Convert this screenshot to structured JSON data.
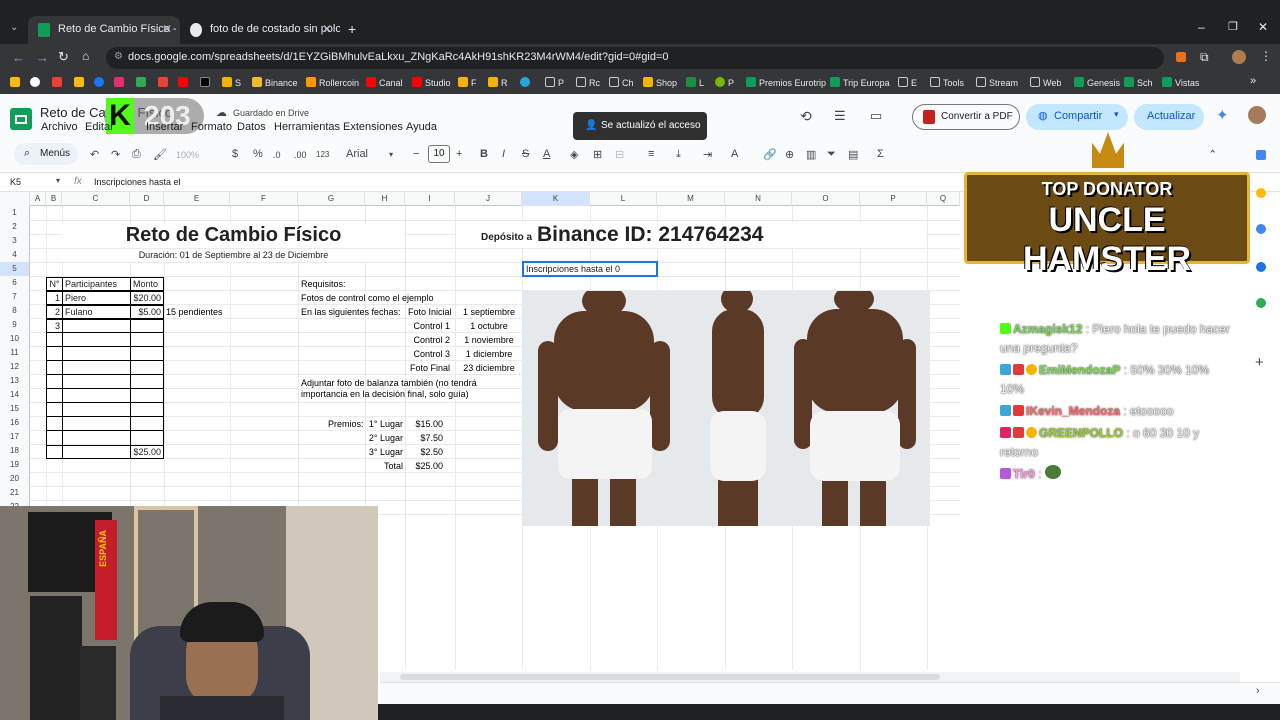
{
  "browser": {
    "tabs": [
      {
        "title": "Reto de Cambio Físico - Hojas d",
        "active": true
      },
      {
        "title": "foto de de costado sin polo - B",
        "active": false
      }
    ],
    "url": "docs.google.com/spreadsheets/d/1EYZGiBMhulvEaLkxu_ZNgKaRc4AkH91shKR23M4rWM4/edit?gid=0#gid=0",
    "bookmarks": [
      "S",
      "Binance",
      "Rollercoin",
      "Canal",
      "Studio",
      "F",
      "R",
      "P",
      "Rc",
      "Ch",
      "Shop",
      "L",
      "P",
      "Premios Eurotrip",
      "Trip Europa",
      "E",
      "Tools",
      "Stream",
      "Web",
      "Genesis",
      "Sch",
      "Vistas"
    ]
  },
  "app": {
    "doc_title": "Reto de Cambio Físico",
    "saved_status": "Guardado en Drive",
    "menus": [
      "Archivo",
      "Editar",
      "Ver",
      "Insertar",
      "Formato",
      "Datos",
      "Herramientas",
      "Extensiones",
      "Ayuda"
    ],
    "toast": "Se actualizó el acceso",
    "convert_pdf": "Convertir a PDF",
    "share": "Compartir",
    "update": "Actualizar",
    "overlay_number": "203"
  },
  "toolbar": {
    "menus_label": "Menús",
    "zoom": "100%",
    "currency": "$",
    "percent": "%",
    "dec_less": ".0",
    "dec_more": ".00",
    "number_fmt": "123",
    "font": "Arial",
    "font_size": "10"
  },
  "formula_bar": {
    "cell_ref": "K5",
    "content": "Inscripciones hasta el"
  },
  "columns": [
    "A",
    "B",
    "C",
    "D",
    "E",
    "F",
    "G",
    "H",
    "I",
    "J",
    "K",
    "L",
    "M",
    "N",
    "O",
    "P",
    "Q"
  ],
  "rows": [
    "1",
    "2",
    "3",
    "4",
    "5",
    "6",
    "7",
    "8",
    "9",
    "10",
    "11",
    "12",
    "13",
    "14",
    "15",
    "16",
    "17",
    "18",
    "19",
    "20",
    "21",
    "22"
  ],
  "sheet": {
    "title": "Reto de Cambio Físico",
    "duration": "Duración: 01 de Septiembre al 23 de Diciembre",
    "deposit_label": "Depósito a",
    "binance": "Binance ID: 214764234",
    "active_cell_text": "Inscripciones hasta el 0",
    "table_headers": [
      "N°",
      "Participantes",
      "Monto"
    ],
    "table_rows": [
      {
        "n": "1",
        "name": "Piero",
        "amount": "$20.00"
      },
      {
        "n": "2",
        "name": "Fulano",
        "amount": "$5.00"
      },
      {
        "n": "3",
        "name": "",
        "amount": ""
      }
    ],
    "pending": "15 pendientes",
    "table_total": "$25.00",
    "requirements": "Requisitos:",
    "control_photos": "Fotos de control como el ejemplo",
    "dates_label": "En las siguientes fechas:",
    "schedule": [
      {
        "label": "Foto Inicial",
        "date": "1 septiembre"
      },
      {
        "label": "Control 1",
        "date": "1 octubre"
      },
      {
        "label": "Control 2",
        "date": "1 noviembre"
      },
      {
        "label": "Control 3",
        "date": "1 diciembre"
      },
      {
        "label": "Foto Final",
        "date": "23 diciembre"
      }
    ],
    "scale_note_1": "Adjuntar foto de balanza también (no tendrá",
    "scale_note_2": "importancia en la decisión final, solo guía)",
    "prizes_label": "Premios:",
    "prizes": [
      {
        "place": "1° Lugar",
        "amount": "$15.00"
      },
      {
        "place": "2° Lugar",
        "amount": "$7.50"
      },
      {
        "place": "3° Lugar",
        "amount": "$2.50"
      },
      {
        "place": "Total",
        "amount": "$25.00"
      }
    ]
  },
  "overlay": {
    "donor_top": "TOP DONATOR",
    "donor_name": "UNCLE HAMSTER",
    "camera_flag": "ESPAÑA",
    "chat": [
      {
        "user": "Azmagisk12",
        "color": "#7ed957",
        "msg": "Piero hola te puedo hacer una pregunta?"
      },
      {
        "user": "EmiMendozaP",
        "color": "#7ed957",
        "msg": "50% 30% 10% 10%"
      },
      {
        "user": "IKevin_Mendoza",
        "color": "#ff6b6b",
        "msg": "etooooo"
      },
      {
        "user": "GREENPOLLO",
        "color": "#9acd32",
        "msg": "o 60 30 10 y retorno"
      },
      {
        "user": "Tir0",
        "color": "#ff9de2",
        "msg": ""
      }
    ]
  },
  "colors": {
    "sheets_green": "#0f9d58",
    "share_bg": "#c2e7ff",
    "selection": "#1a73e8"
  }
}
